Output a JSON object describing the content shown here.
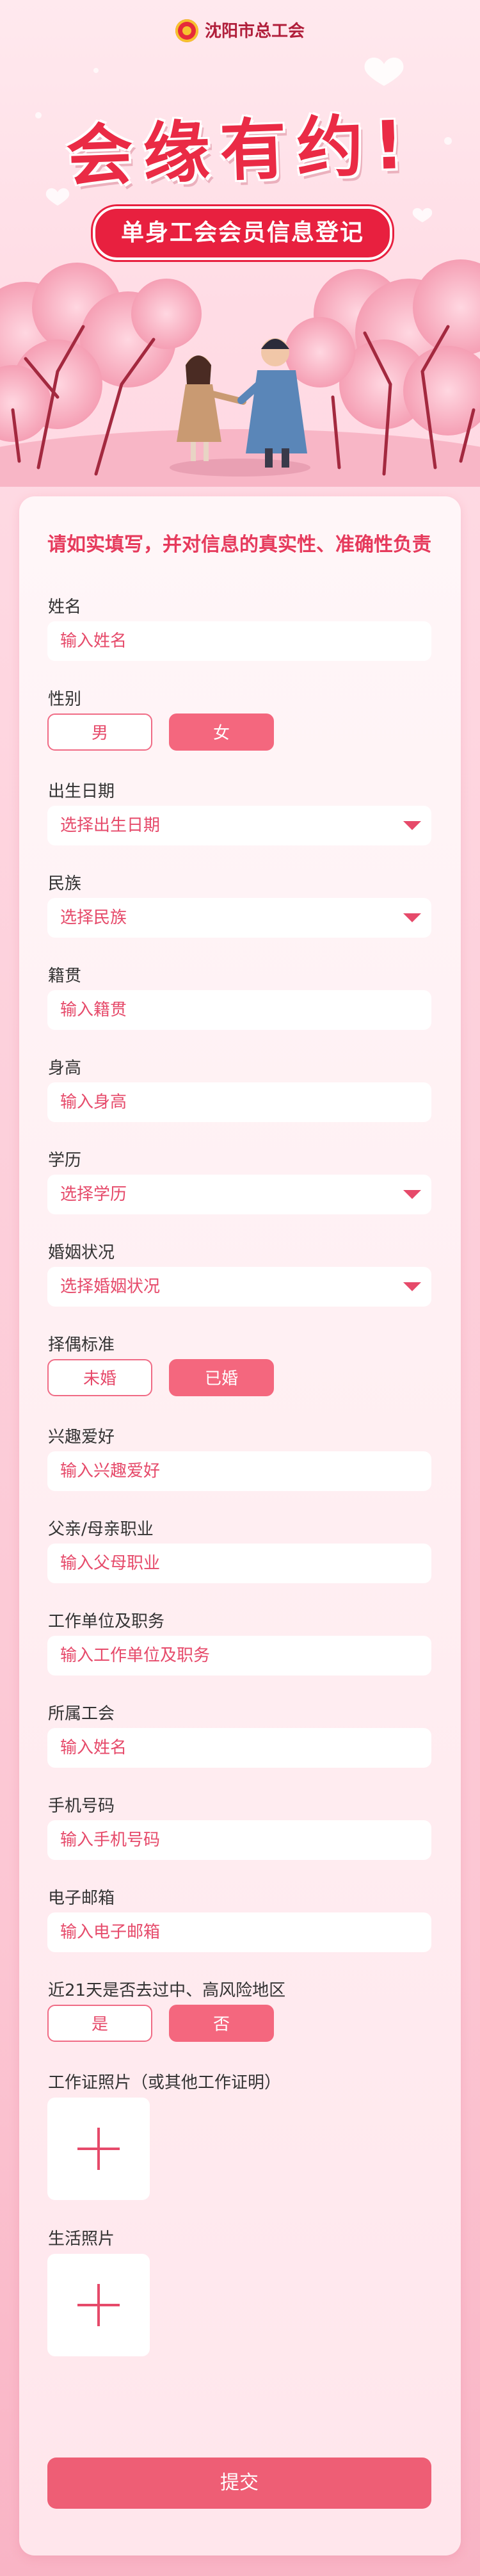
{
  "header": {
    "org_name": "沈阳市总工会",
    "title": "会缘有约!",
    "subtitle": "单身工会会员信息登记"
  },
  "form": {
    "notice": "请如实填写，并对信息的真实性、准确性负责",
    "name": {
      "label": "姓名",
      "placeholder": "输入姓名"
    },
    "gender": {
      "label": "性别",
      "options": [
        "男",
        "女"
      ],
      "selected": "女"
    },
    "birth": {
      "label": "出生日期",
      "placeholder": "选择出生日期"
    },
    "ethnicity": {
      "label": "民族",
      "placeholder": "选择民族"
    },
    "hometown": {
      "label": "籍贯",
      "placeholder": "输入籍贯"
    },
    "height": {
      "label": "身高",
      "placeholder": "输入身高"
    },
    "education": {
      "label": "学历",
      "placeholder": "选择学历"
    },
    "marital": {
      "label": "婚姻状况",
      "placeholder": "选择婚姻状况"
    },
    "partner_standard": {
      "label": "择偶标准",
      "options": [
        "未婚",
        "已婚"
      ],
      "selected": "已婚"
    },
    "hobbies": {
      "label": "兴趣爱好",
      "placeholder": "输入兴趣爱好"
    },
    "parents_job": {
      "label": "父亲/母亲职业",
      "placeholder": "输入父母职业"
    },
    "employer": {
      "label": "工作单位及职务",
      "placeholder": "输入工作单位及职务"
    },
    "union": {
      "label": "所属工会",
      "placeholder": "输入姓名"
    },
    "phone": {
      "label": "手机号码",
      "placeholder": "输入手机号码"
    },
    "email": {
      "label": "电子邮箱",
      "placeholder": "输入电子邮箱"
    },
    "risk_area": {
      "label": "近21天是否去过中、高风险地区",
      "options": [
        "是",
        "否"
      ],
      "selected": "否"
    },
    "work_photo": {
      "label": "工作证照片（或其他工作证明）"
    },
    "life_photo": {
      "label": "生活照片"
    },
    "submit_label": "提交"
  },
  "icons": {
    "logo": "union-logo-icon",
    "dropdown": "triangle-down-icon",
    "upload": "plus-icon"
  },
  "colors": {
    "accent": "#e8203f",
    "primary_button": "#ee5e75",
    "placeholder": "#e64a6a",
    "background": "#fcc6d3"
  }
}
